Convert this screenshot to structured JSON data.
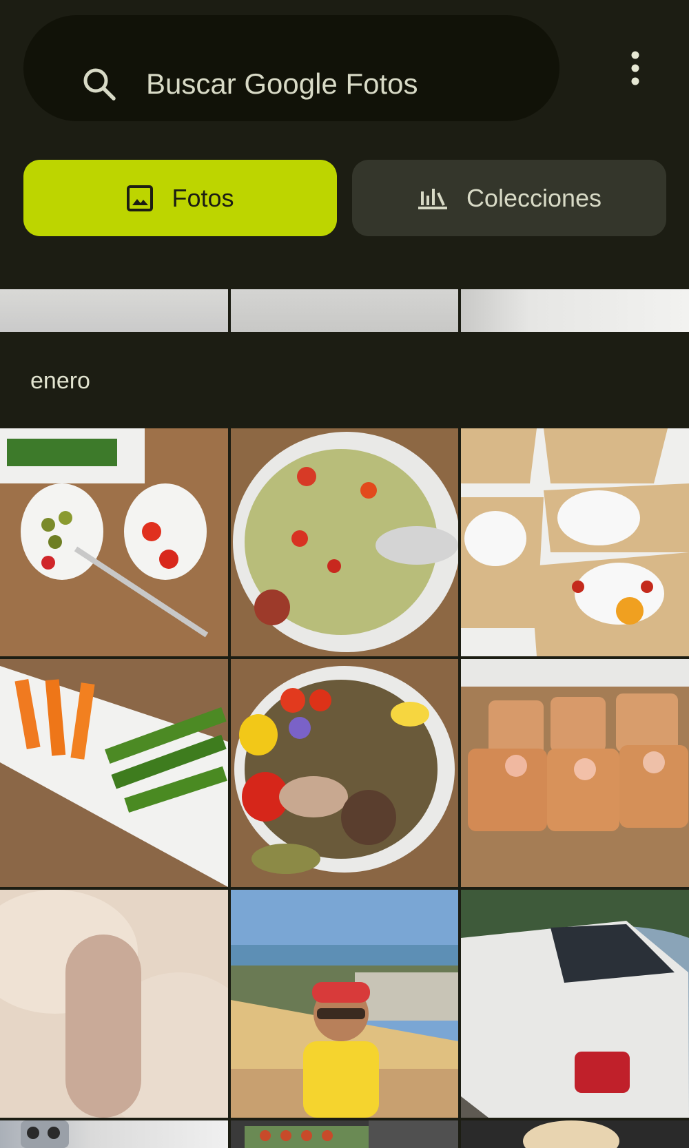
{
  "search": {
    "placeholder": "Buscar Google Fotos",
    "icon": "search-icon"
  },
  "menu": {
    "icon": "more-vert-icon"
  },
  "tabs": [
    {
      "label": "Fotos",
      "icon": "image-icon",
      "selected": true
    },
    {
      "label": "Colecciones",
      "icon": "collections-icon",
      "selected": false
    }
  ],
  "section": {
    "month": "enero"
  },
  "colors": {
    "accent": "#bdd500",
    "background": "#1c1d13"
  }
}
